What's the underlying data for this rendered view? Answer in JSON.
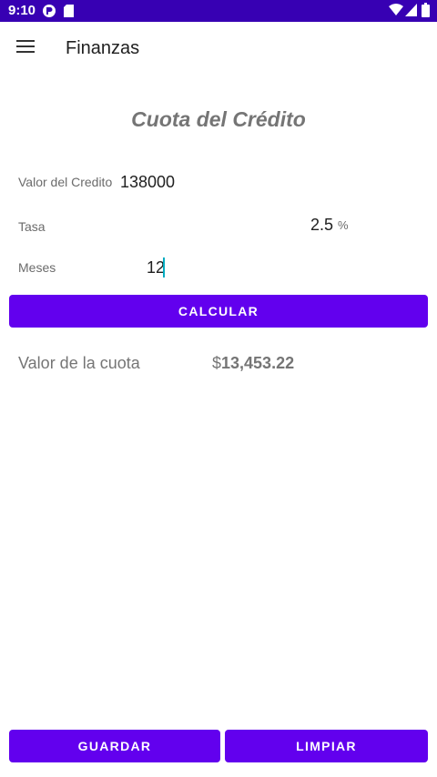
{
  "status_bar": {
    "time": "9:10",
    "left_icons": [
      "status-app-icon",
      "sd-card-icon"
    ],
    "right_icons": [
      "wifi-icon",
      "signal-icon",
      "battery-icon"
    ]
  },
  "app_bar": {
    "menu_icon": "menu-icon",
    "title": "Finanzas"
  },
  "page_title": "Cuota del Crédito",
  "form": {
    "valor_label": "Valor del Credito",
    "valor_value": "138000",
    "tasa_label": "Tasa",
    "tasa_value": "2.5",
    "tasa_unit": "%",
    "meses_label": "Meses",
    "meses_value": "12"
  },
  "buttons": {
    "calcular": "CALCULAR",
    "guardar": "GUARDAR",
    "limpiar": "LIMPIAR"
  },
  "result": {
    "label": "Valor de la cuota",
    "currency": "$",
    "amount": "13,453.22"
  },
  "colors": {
    "status_bar": "#3700b3",
    "primary": "#6200ee",
    "cursor": "#00acc1"
  }
}
